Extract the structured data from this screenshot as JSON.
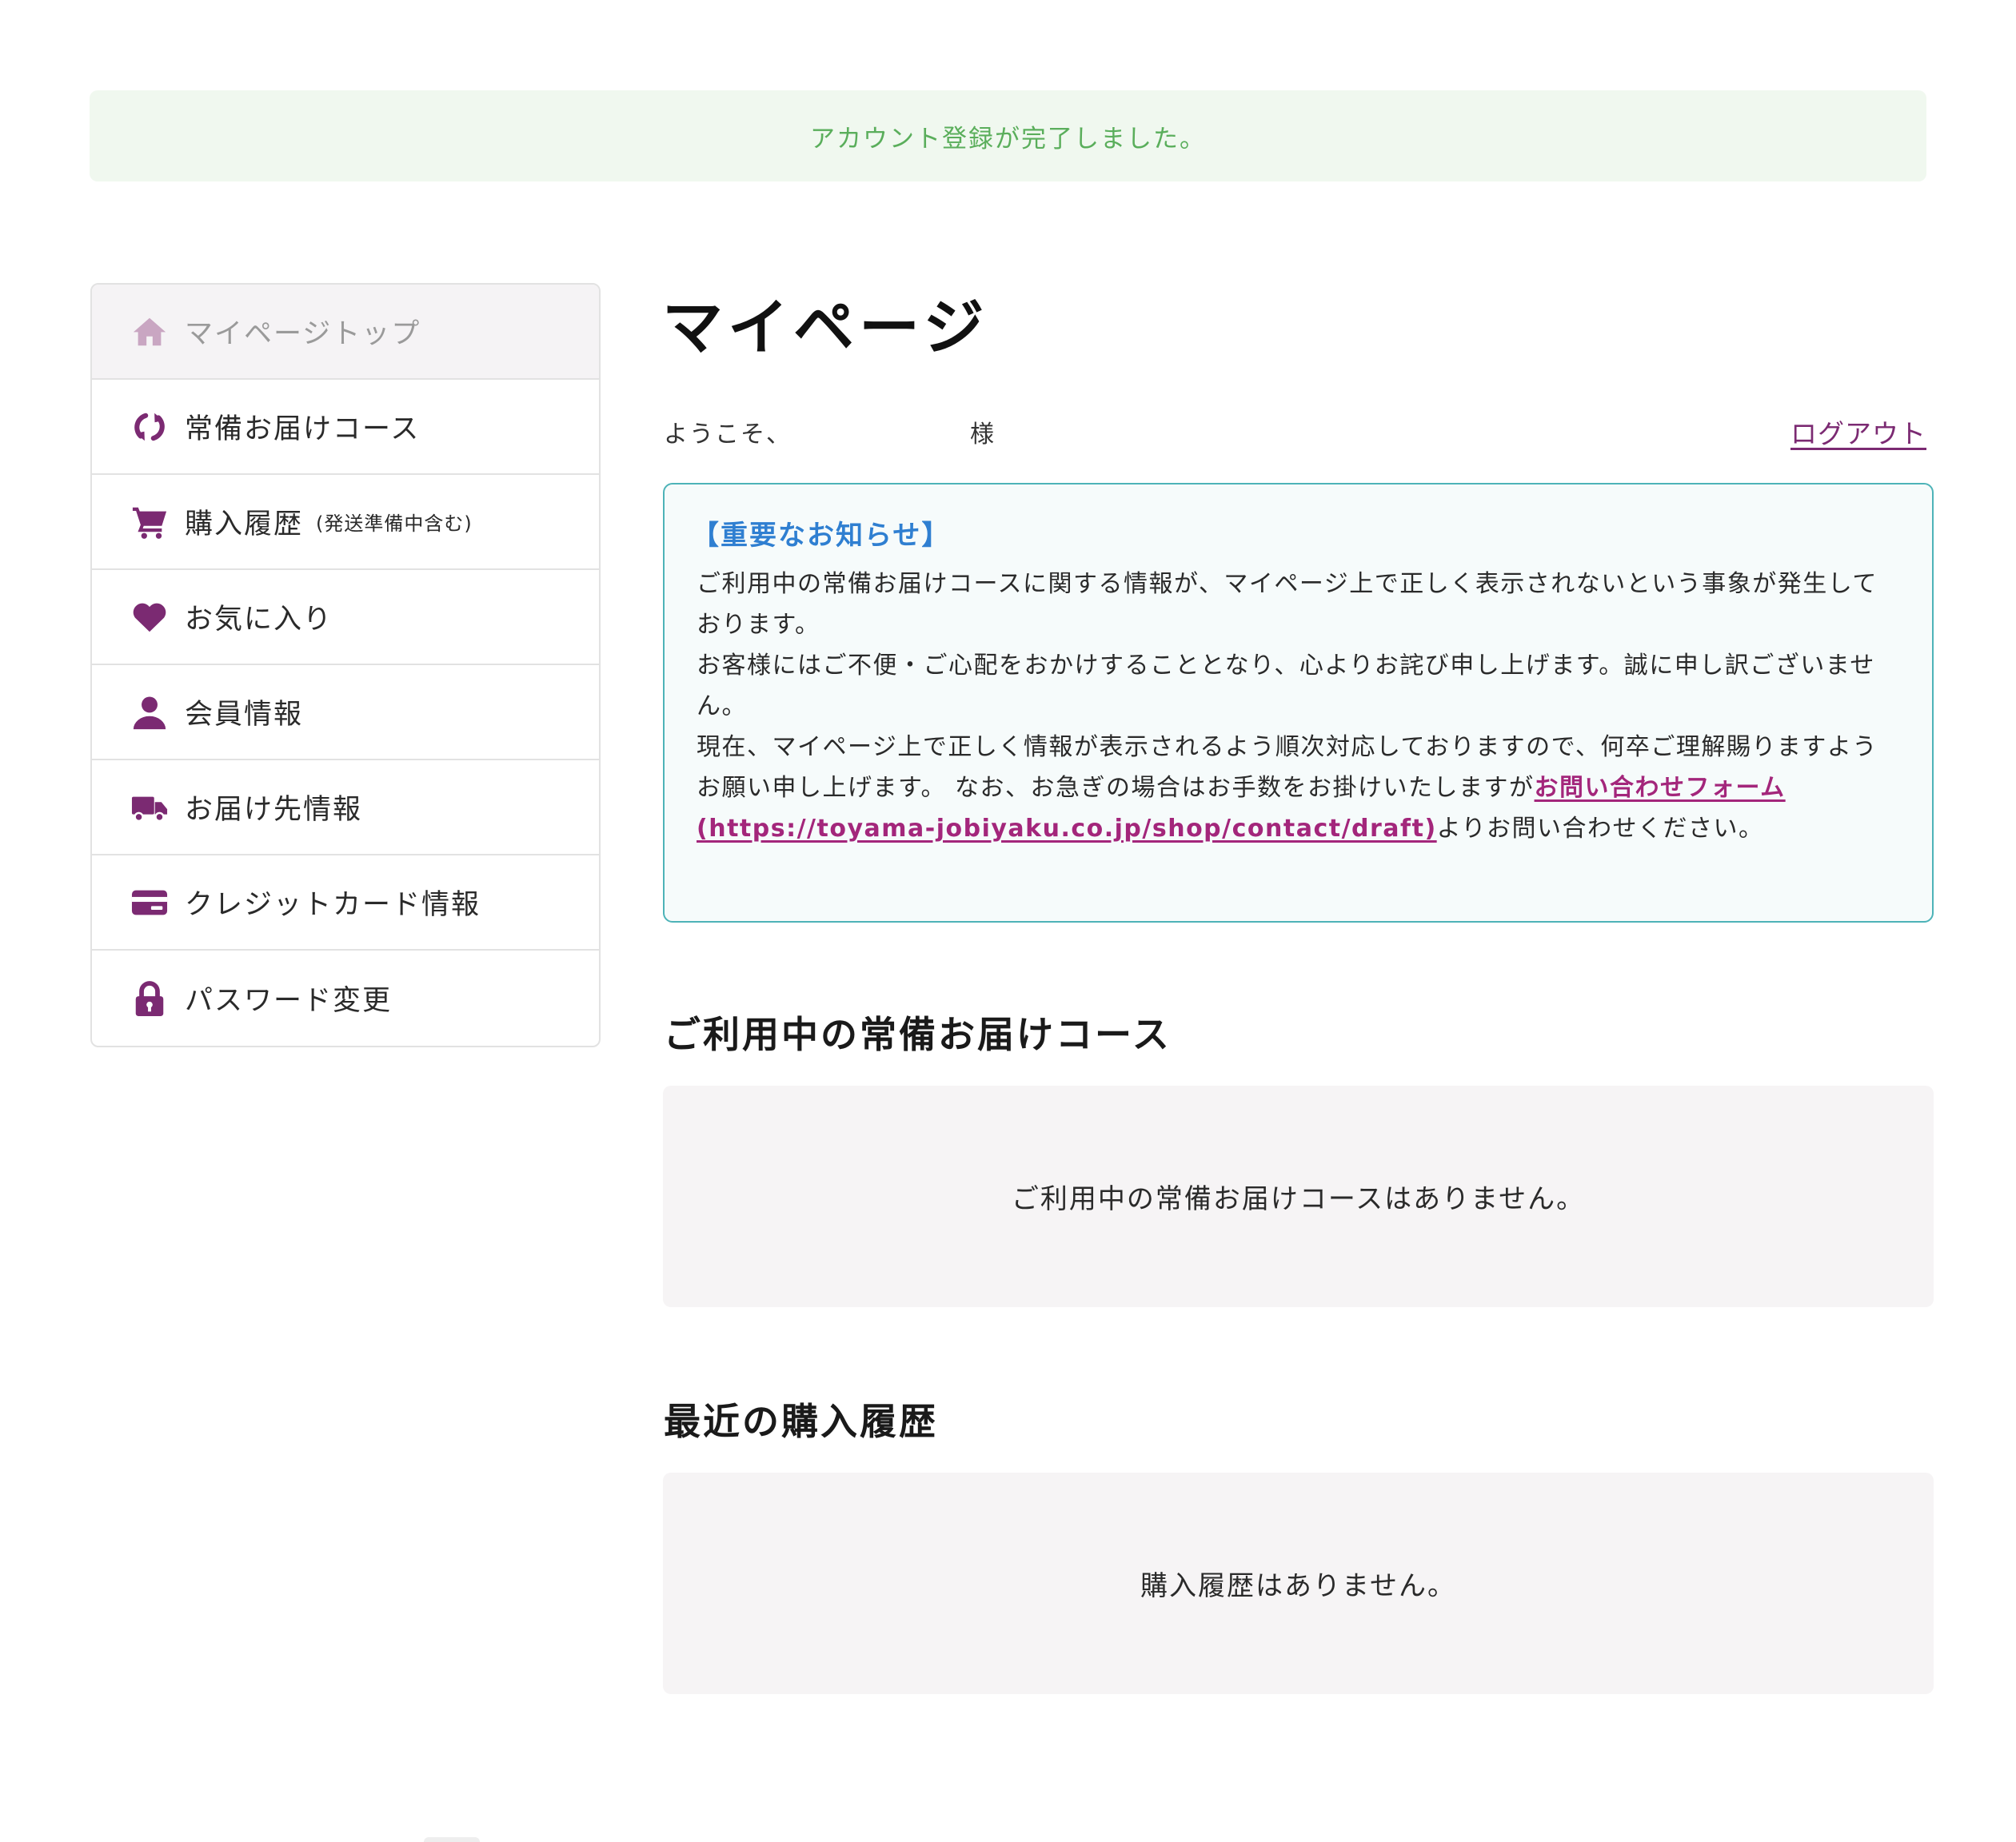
{
  "flash": {
    "message": "アカウント登録が完了しました。",
    "color": "#5aae5b",
    "background": "#f0f8ef"
  },
  "sidebar": {
    "items": [
      {
        "label": "マイページトップ",
        "icon": "home-icon",
        "active": true
      },
      {
        "label": "常備お届けコース",
        "icon": "refresh-icon"
      },
      {
        "label": "購入履歴",
        "sub": "(発送準備中含む)",
        "icon": "cart-icon"
      },
      {
        "label": "お気に入り",
        "icon": "heart-icon"
      },
      {
        "label": "会員情報",
        "icon": "user-icon"
      },
      {
        "label": "お届け先情報",
        "icon": "truck-icon"
      },
      {
        "label": "クレジットカード情報",
        "icon": "credit-card-icon"
      },
      {
        "label": "パスワード変更",
        "icon": "lock-icon"
      }
    ],
    "icon_color": "#7b2a72",
    "active_icon_color": "#c9a6c2"
  },
  "main": {
    "title": "マイページ",
    "welcome_prefix": "ようこそ、",
    "welcome_suffix": "様",
    "logout_label": "ログアウト",
    "notice": {
      "title": "【重要なお知らせ】",
      "line1": "ご利用中の常備お届けコースに関する情報が、マイページ上で正しく表示されないという事象が発生しております。",
      "line2": "お客様にはご不便・ご心配をおかけすることとなり、心よりお詫び申し上げます。誠に申し訳ございません。",
      "line3": "現在、マイページ上で正しく情報が表示されるよう順次対応しておりますので、何卒ご理解賜りますようお願い申し上げます。 なお、お急ぎの場合はお手数をお掛けいたしますが",
      "link_label": "お問い合わせフォーム(https://toyama-jobiyaku.co.jp/shop/contact/draft)",
      "line3_end": "よりお問い合わせください。"
    },
    "subscriptions": {
      "heading": "ご利用中の常備お届けコース",
      "empty": "ご利用中の常備お届けコースはありません。"
    },
    "history": {
      "heading": "最近の購入履歴",
      "empty": "購入履歴はありません。"
    },
    "accent_color": "#7b2a72",
    "notice_border_color": "#4db3b8",
    "notice_title_color": "#2f7fd1",
    "link_color": "#a3267b"
  }
}
